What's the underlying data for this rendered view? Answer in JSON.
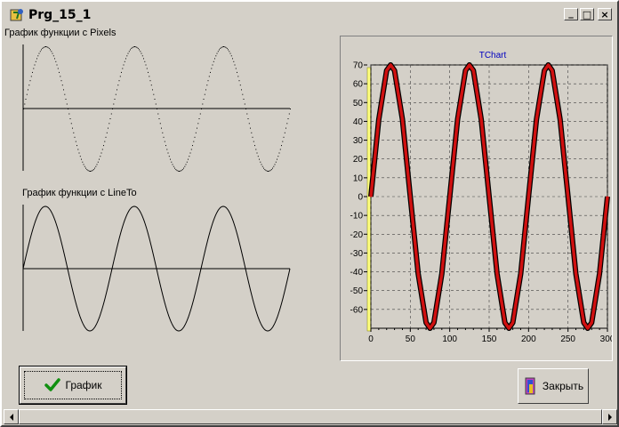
{
  "window": {
    "title": "Prg_15_1",
    "icon": "app-icon",
    "controls": {
      "minimize": "_",
      "maximize": "□",
      "close": "×"
    }
  },
  "labels": {
    "pixels": "График функции с Pixels",
    "lineto": "График функции с LineTo"
  },
  "chart_data": {
    "type": "line",
    "title": "TChart",
    "function": "70·sin(2π·x/100)",
    "x": [
      0,
      10,
      20,
      25,
      30,
      40,
      50,
      60,
      70,
      75,
      80,
      90,
      100,
      110,
      120,
      125,
      130,
      140,
      150,
      160,
      170,
      175,
      180,
      190,
      200,
      210,
      220,
      225,
      230,
      240,
      250,
      260,
      270,
      275,
      280,
      290,
      300
    ],
    "y": [
      0,
      41,
      67,
      70,
      67,
      41,
      0,
      -41,
      -67,
      -70,
      -67,
      -41,
      0,
      41,
      67,
      70,
      67,
      41,
      0,
      -41,
      -67,
      -70,
      -67,
      -41,
      0,
      41,
      67,
      70,
      67,
      41,
      0,
      -41,
      -67,
      -70,
      -67,
      -41,
      0
    ],
    "xlim": [
      0,
      300
    ],
    "ylim": [
      -70,
      70
    ],
    "xticks": [
      0,
      50,
      100,
      150,
      200,
      250,
      300
    ],
    "yticks": [
      70,
      60,
      50,
      40,
      30,
      20,
      10,
      0,
      -10,
      -20,
      -30,
      -40,
      -50,
      -60
    ],
    "grid": true,
    "series_color": "#d01010"
  },
  "buttons": {
    "plot": {
      "label": "График",
      "icon": "checkmark-icon"
    },
    "close": {
      "label": "Закрыть",
      "icon": "door-icon"
    }
  },
  "colors": {
    "face": "#d4d0c8",
    "series": "#d01010",
    "title": "#0000c0"
  }
}
